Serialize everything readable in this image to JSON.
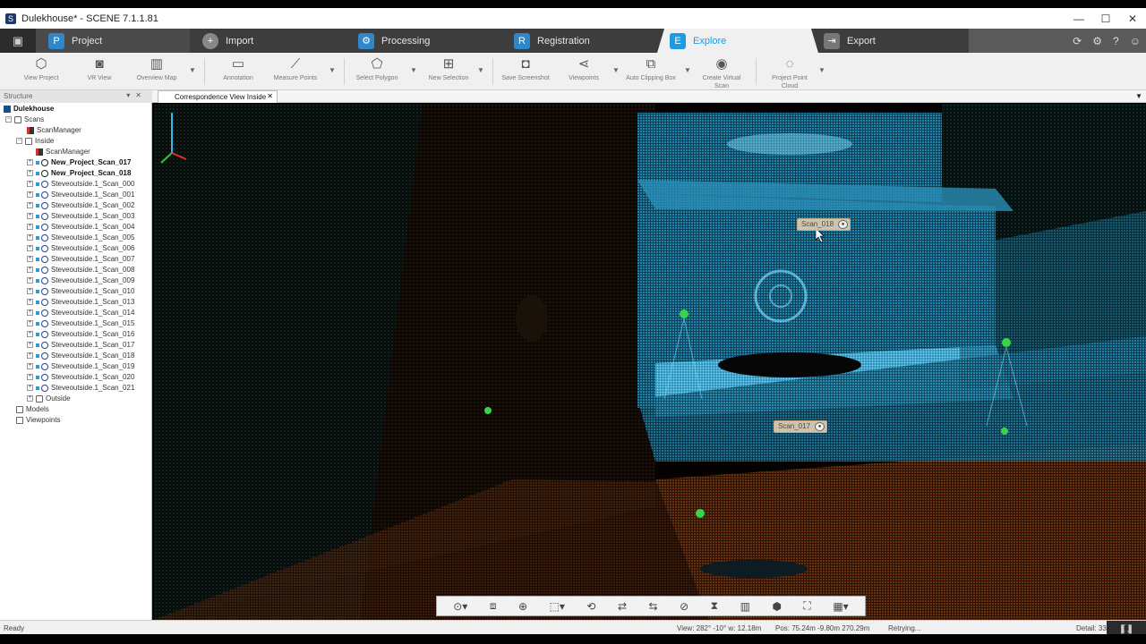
{
  "window": {
    "app_icon": "S",
    "title": "Dulekhouse* - SCENE 7.1.1.81",
    "controls": [
      "—",
      "☐",
      "✕"
    ]
  },
  "tabs": [
    {
      "label": "Project",
      "icon": "P"
    },
    {
      "label": "Import",
      "icon": "+"
    },
    {
      "label": "Processing",
      "icon": "⚙"
    },
    {
      "label": "Registration",
      "icon": "R"
    },
    {
      "label": "Explore",
      "icon": "E"
    },
    {
      "label": "Export",
      "icon": "⇥"
    }
  ],
  "header_icons": [
    "refresh-icon",
    "gear-icon",
    "help-icon",
    "user-icon"
  ],
  "toolbar": {
    "view_project": "View Project",
    "vr_view": "VR View",
    "overview_map": "Overview Map",
    "annotation": "Annotation",
    "measure_points": "Measure Points",
    "select_polygon": "Select Polygon",
    "new_selection": "New Selection",
    "save_screenshot": "Save Screenshot",
    "viewpoints": "Viewpoints",
    "auto_clipping_box": "Auto Clipping Box",
    "create_virtual_scan": "Create Virtual Scan",
    "project_point_cloud": "Project Point Cloud"
  },
  "structure": {
    "header": "Structure",
    "view_tab": "Correspondence View Inside",
    "tree": {
      "root": "Dulekhouse",
      "scans": "Scans",
      "scan_manager": "ScanManager",
      "inside": "Inside",
      "inside_manager": "ScanManager",
      "project_scans": [
        "New_Project_Scan_017",
        "New_Project_Scan_018"
      ],
      "steve_scans": [
        "Steveoutside.1_Scan_000",
        "Steveoutside.1_Scan_001",
        "Steveoutside.1_Scan_002",
        "Steveoutside.1_Scan_003",
        "Steveoutside.1_Scan_004",
        "Steveoutside.1_Scan_005",
        "Steveoutside.1_Scan_006",
        "Steveoutside.1_Scan_007",
        "Steveoutside.1_Scan_008",
        "Steveoutside.1_Scan_009",
        "Steveoutside.1_Scan_010",
        "Steveoutside.1_Scan_013",
        "Steveoutside.1_Scan_014",
        "Steveoutside.1_Scan_015",
        "Steveoutside.1_Scan_016",
        "Steveoutside.1_Scan_017",
        "Steveoutside.1_Scan_018",
        "Steveoutside.1_Scan_019",
        "Steveoutside.1_Scan_020",
        "Steveoutside.1_Scan_021"
      ],
      "outside": "Outside",
      "models": "Models",
      "viewpoints": "Viewpoints"
    }
  },
  "viewport": {
    "scan_label_a": "Scan_018",
    "scan_label_b": "Scan_017"
  },
  "status": {
    "ready": "Ready",
    "view": "View: 282° -10° w: 12.18m",
    "pos": "Pos: 75.24m -9.80m 270.29m",
    "retry": "Retrying...",
    "detail": "Detail: 33"
  },
  "colors": {
    "accent": "#1e9be0",
    "ribbon": "#3d3d3d",
    "cloud_cyan": "#2fb6e8",
    "cloud_orange": "#b5561c"
  }
}
